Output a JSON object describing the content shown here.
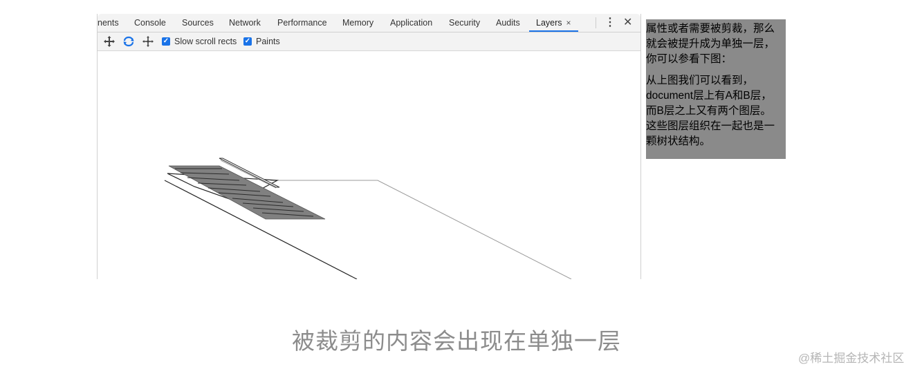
{
  "devtools": {
    "tabs": [
      {
        "label": "nents"
      },
      {
        "label": "Console"
      },
      {
        "label": "Sources"
      },
      {
        "label": "Network"
      },
      {
        "label": "Performance"
      },
      {
        "label": "Memory"
      },
      {
        "label": "Application"
      },
      {
        "label": "Security"
      },
      {
        "label": "Audits"
      },
      {
        "label": "Layers",
        "active": true,
        "close": "×"
      }
    ],
    "more_icon": "⋮",
    "close_icon": "✕",
    "toolbar": {
      "icons": [
        "pan-icon",
        "rotate-icon",
        "reset-transform-icon"
      ],
      "checkboxes": [
        {
          "label": "Slow scroll rects",
          "checked": true
        },
        {
          "label": "Paints",
          "checked": true
        }
      ]
    },
    "accent_color": "#1a73e8"
  },
  "note": {
    "paragraph1": "属性或者需要被剪裁，那么\n就会被提升成为单独一层，\n你可以参看下图：",
    "paragraph2": "从上图我们可以看到，\ndocument层上有A和B层，\n而B层之上又有两个图层。\n这些图层组织在一起也是一\n颗树状结构。"
  },
  "caption": "被裁剪的内容会出现在单独一层",
  "watermark": "@稀土掘金技术社区"
}
